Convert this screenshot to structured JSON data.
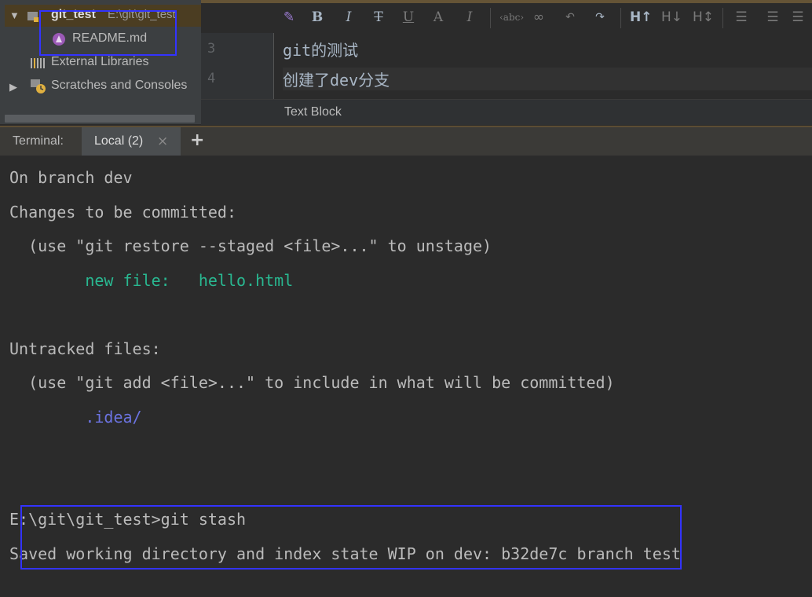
{
  "project_tree": {
    "root_name": "git_test",
    "root_path": "E:\\git\\git_test",
    "items": [
      {
        "label": "README.md"
      },
      {
        "label": "External Libraries"
      },
      {
        "label": "Scratches and Consoles"
      }
    ]
  },
  "editor": {
    "lines": [
      {
        "number": "3",
        "text": "git的测试"
      },
      {
        "number": "4",
        "text": "创建了dev分支"
      }
    ],
    "breadcrumb": "Text Block"
  },
  "terminal": {
    "label": "Terminal:",
    "tab": "Local (2)",
    "tab_close": "×",
    "add": "+",
    "output": {
      "l1": "On branch dev",
      "l2": "Changes to be committed:",
      "l3": "  (use \"git restore --staged <file>...\" to unstage)",
      "l4_label": "        new file:   ",
      "l4_file": "hello.html",
      "l5": "Untracked files:",
      "l6": "  (use \"git add <file>...\" to include in what will be committed)",
      "l7": "        .idea/",
      "l8": "E:\\git\\git_test>git stash",
      "l9": "Saved working directory and index state WIP on dev: b32de7c branch test"
    }
  },
  "colors": {
    "accent_green": "#29b891",
    "untracked_blue": "#6b73e0",
    "highlight_box": "#3333ff"
  }
}
